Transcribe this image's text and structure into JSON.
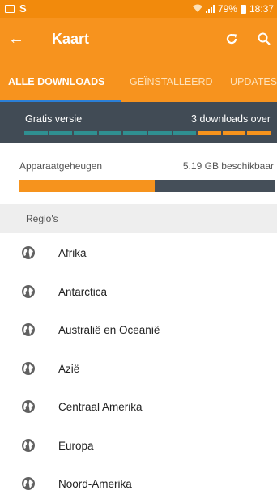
{
  "status": {
    "left_icon": "image-icon",
    "app_letter": "S",
    "battery_percent": "79%",
    "time": "18:37"
  },
  "appbar": {
    "title": "Kaart",
    "back_icon": "arrow-left-icon",
    "refresh_icon": "refresh-icon",
    "search_icon": "search-icon"
  },
  "tabs": [
    {
      "label": "ALLE DOWNLOADS",
      "active": true
    },
    {
      "label": "GEÏNSTALLEERD",
      "active": false
    },
    {
      "label": "UPDATES",
      "active": false
    }
  ],
  "free": {
    "label": "Gratis versie",
    "count": "3 downloads over",
    "downloads_used": 7,
    "downloads_total": 10
  },
  "storage": {
    "label": "Apparaatgeheugen",
    "available": "5.19 GB beschikbaar",
    "used_fraction": 0.53
  },
  "regions": {
    "header": "Regio's",
    "items": [
      "Afrika",
      "Antarctica",
      "Australië en Oceanië",
      "Azië",
      "Centraal Amerika",
      "Europa",
      "Noord-Amerika"
    ]
  },
  "colors": {
    "accent": "#f7931e",
    "statusbar": "#f28a0c",
    "dark": "#414b55",
    "teal": "#2f8f91",
    "indicator": "#2b7fd6"
  }
}
